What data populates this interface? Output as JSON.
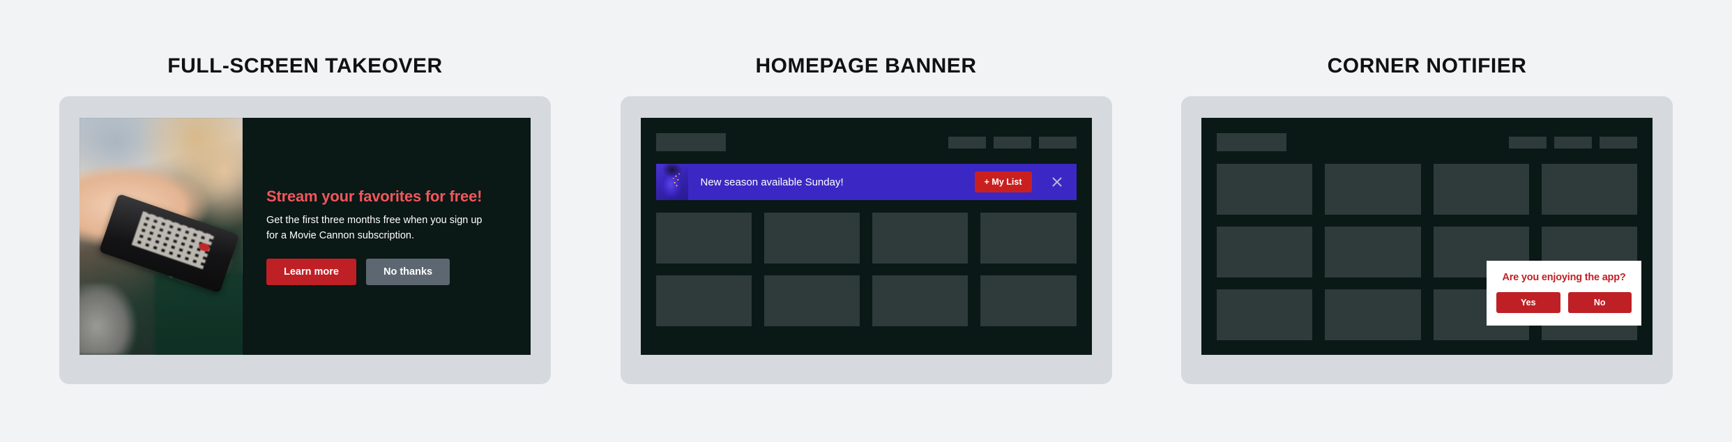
{
  "panels": [
    {
      "heading": "FULL-SCREEN TAKEOVER",
      "type": "takeover",
      "photo_alt": "hand-holding-remote-photo",
      "title": "Stream your favorites for free!",
      "body": "Get the first three months free when you sign up for a Movie Cannon subscription.",
      "primary_button": "Learn more",
      "secondary_button": "No thanks"
    },
    {
      "heading": "HOMEPAGE BANNER",
      "type": "banner",
      "banner": {
        "avatar_alt": "promo-portrait-thumbnail",
        "message": "New season available Sunday!",
        "cta_label": "+ My List",
        "close_icon": "close-x-icon"
      }
    },
    {
      "heading": "CORNER NOTIFIER",
      "type": "notifier",
      "notifier": {
        "title": "Are you enjoying the app?",
        "yes_label": "Yes",
        "no_label": "No"
      }
    }
  ],
  "colors": {
    "page_background": "#f2f3f5",
    "device_frame": "#d6dade",
    "screen_background": "#0a1816",
    "tile": "#2f3a3a",
    "brand_red": "#bf2025",
    "accent_coral": "#f2565b",
    "banner_purple": "#3b28c4",
    "secondary_gray": "#5d6771",
    "heading_text": "#111111"
  },
  "mock_ui": {
    "nav_logo_alt": "app-logo-placeholder",
    "nav_link_count": 3,
    "grid_columns": 4
  }
}
